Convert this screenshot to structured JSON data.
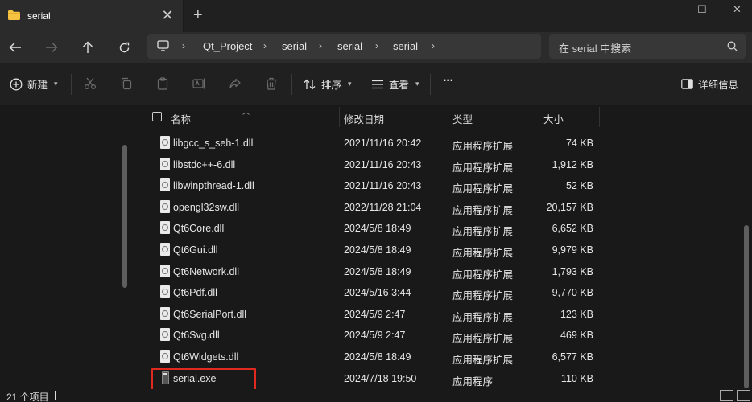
{
  "window": {
    "tab_title": "serial",
    "tab_close": "✕",
    "new_tab": "+",
    "minimize": "—",
    "maximize": "☐",
    "close": "✕"
  },
  "address": {
    "crumbs": [
      "Qt_Project",
      "serial",
      "serial",
      "serial"
    ],
    "separator": "›"
  },
  "search": {
    "placeholder": "在 serial 中搜索"
  },
  "toolbar": {
    "new_label": "新建",
    "sort_label": "排序",
    "view_label": "查看",
    "more_label": "···",
    "details_label": "详细信息"
  },
  "columns": {
    "name": "名称",
    "date": "修改日期",
    "type": "类型",
    "size": "大小"
  },
  "files": [
    {
      "name": "libgcc_s_seh-1.dll",
      "date": "2021/11/16 20:42",
      "type": "应用程序扩展",
      "size": "74 KB",
      "kind": "dll"
    },
    {
      "name": "libstdc++-6.dll",
      "date": "2021/11/16 20:43",
      "type": "应用程序扩展",
      "size": "1,912 KB",
      "kind": "dll"
    },
    {
      "name": "libwinpthread-1.dll",
      "date": "2021/11/16 20:43",
      "type": "应用程序扩展",
      "size": "52 KB",
      "kind": "dll"
    },
    {
      "name": "opengl32sw.dll",
      "date": "2022/11/28 21:04",
      "type": "应用程序扩展",
      "size": "20,157 KB",
      "kind": "dll"
    },
    {
      "name": "Qt6Core.dll",
      "date": "2024/5/8 18:49",
      "type": "应用程序扩展",
      "size": "6,652 KB",
      "kind": "dll"
    },
    {
      "name": "Qt6Gui.dll",
      "date": "2024/5/8 18:49",
      "type": "应用程序扩展",
      "size": "9,979 KB",
      "kind": "dll"
    },
    {
      "name": "Qt6Network.dll",
      "date": "2024/5/8 18:49",
      "type": "应用程序扩展",
      "size": "1,793 KB",
      "kind": "dll"
    },
    {
      "name": "Qt6Pdf.dll",
      "date": "2024/5/16 3:44",
      "type": "应用程序扩展",
      "size": "9,770 KB",
      "kind": "dll"
    },
    {
      "name": "Qt6SerialPort.dll",
      "date": "2024/5/9 2:47",
      "type": "应用程序扩展",
      "size": "123 KB",
      "kind": "dll"
    },
    {
      "name": "Qt6Svg.dll",
      "date": "2024/5/9 2:47",
      "type": "应用程序扩展",
      "size": "469 KB",
      "kind": "dll"
    },
    {
      "name": "Qt6Widgets.dll",
      "date": "2024/5/8 18:49",
      "type": "应用程序扩展",
      "size": "6,577 KB",
      "kind": "dll"
    },
    {
      "name": "serial.exe",
      "date": "2024/7/18 19:50",
      "type": "应用程序",
      "size": "110 KB",
      "kind": "exe",
      "highlighted": true
    }
  ],
  "status": {
    "item_count": "21 个项目"
  },
  "colors": {
    "highlight_border": "#e02a20",
    "folder_yellow": "#f5c242"
  }
}
